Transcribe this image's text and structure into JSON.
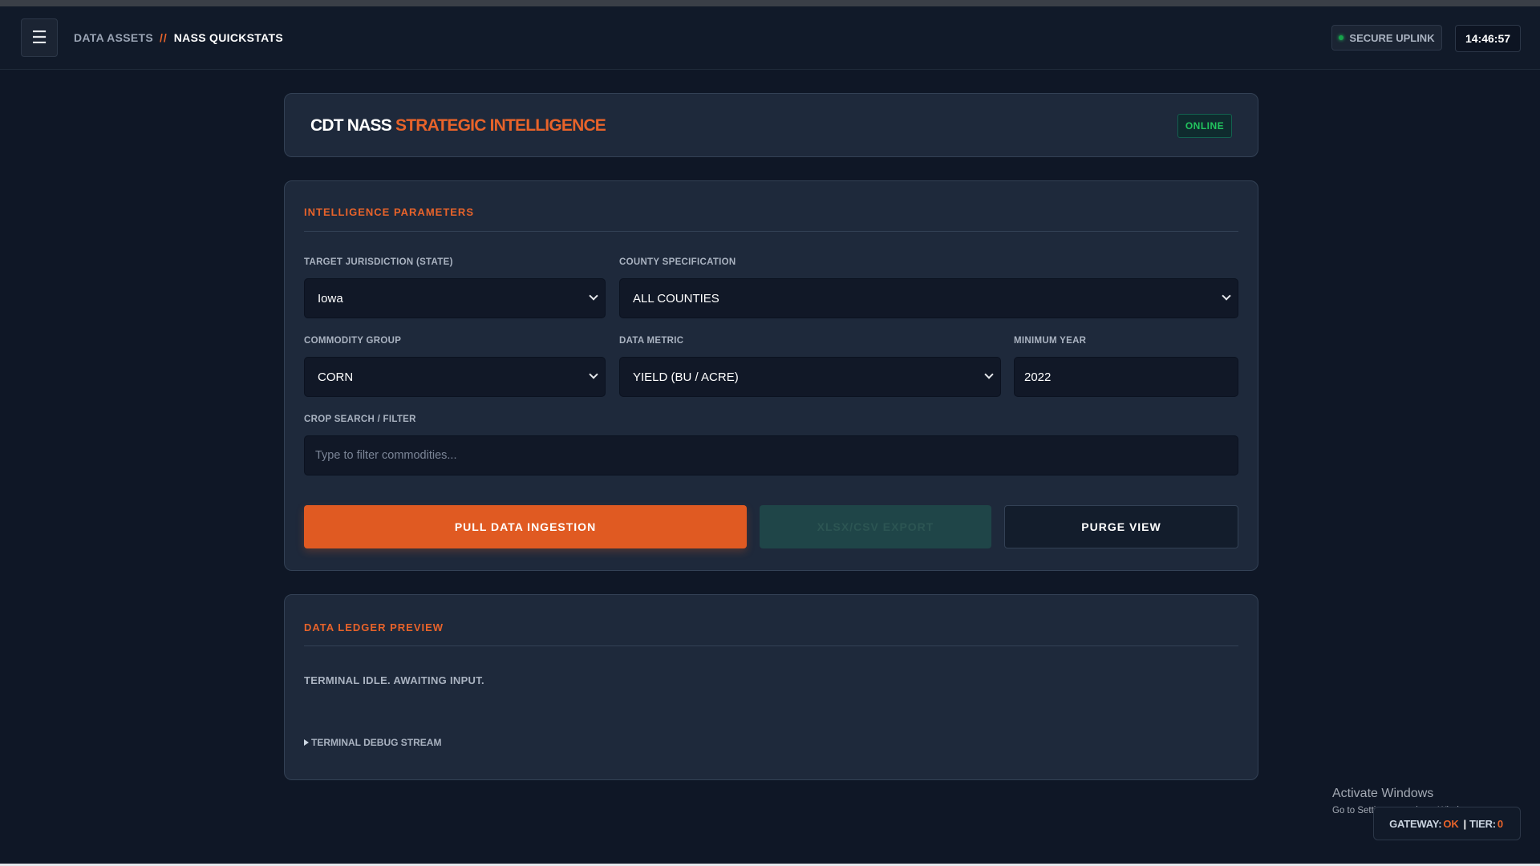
{
  "topbar": {
    "menu_icon": "☰",
    "breadcrumb": [
      "DATA ASSETS",
      "//",
      "NASS QUICKSTATS"
    ],
    "uplink_label": "SECURE UPLINK",
    "clock": "14:46:57"
  },
  "hero": {
    "title_white": "CDT NASS",
    "title_orange": "STRATEGIC INTELLIGENCE",
    "status": "ONLINE"
  },
  "params": {
    "section_title": "INTELLIGENCE PARAMETERS",
    "state_label": "TARGET JURISDICTION (STATE)",
    "state_value": "Iowa",
    "county_label": "COUNTY SPECIFICATION",
    "county_value": "ALL COUNTIES",
    "commodity_label": "COMMODITY GROUP",
    "commodity_value": "CORN",
    "metric_label": "DATA METRIC",
    "metric_value": "YIELD (BU / ACRE)",
    "year_label": "MINIMUM YEAR",
    "year_value": "2022",
    "search_label": "CROP SEARCH / FILTER",
    "search_placeholder": "Type to filter commodities...",
    "pull_button": "PULL DATA INGESTION",
    "export_button": "XLSX/CSV EXPORT",
    "purge_button": "PURGE VIEW"
  },
  "ledger": {
    "section_title": "DATA LEDGER PREVIEW",
    "idle_text": "TERMINAL IDLE. AWAITING INPUT.",
    "debug_label": "TERMINAL DEBUG STREAM"
  },
  "watermark": {
    "line1": "Activate Windows",
    "line2": "Go to Settings to activate Windows."
  },
  "footer": {
    "gateway_label": "GATEWAY:",
    "gateway_value": "OK",
    "separator": "|",
    "tier_label": "TIER:",
    "tier_value": "0"
  },
  "colors": {
    "accent": "#e8632a",
    "background": "#0f1726",
    "card": "#1e293b",
    "online_green": "#22c55e"
  }
}
